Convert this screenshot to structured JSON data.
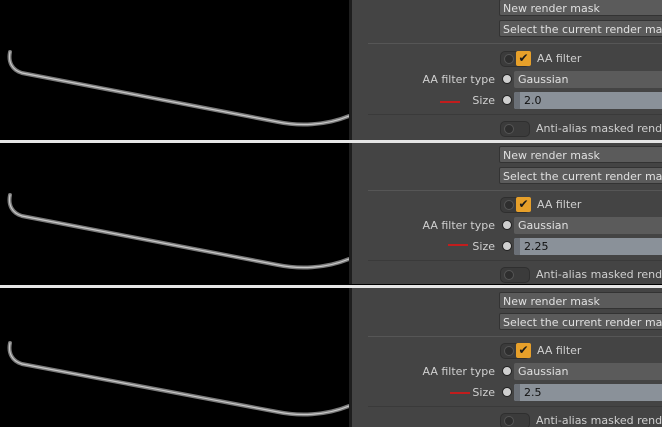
{
  "panels": [
    {
      "new_render_mask": "New render mask",
      "select_mask": "Select the current render mask",
      "aa_filter_label": "AA filter",
      "aa_filter_checked": true,
      "aa_filter_type_label": "AA filter type",
      "aa_filter_type_value": "Gaussian",
      "size_label": "Size",
      "size_value": "2.0",
      "anti_alias_label": "Anti-alias masked render o"
    },
    {
      "new_render_mask": "New render mask",
      "select_mask": "Select the current render mask",
      "aa_filter_label": "AA filter",
      "aa_filter_checked": true,
      "aa_filter_type_label": "AA filter type",
      "aa_filter_type_value": "Gaussian",
      "size_label": "Size",
      "size_value": "2.25",
      "anti_alias_label": "Anti-alias masked render o"
    },
    {
      "new_render_mask": "New render mask",
      "select_mask": "Select the current render mask",
      "aa_filter_label": "AA filter",
      "aa_filter_checked": true,
      "aa_filter_type_label": "AA filter type",
      "aa_filter_type_value": "Gaussian",
      "size_label": "Size",
      "size_value": "2.5",
      "anti_alias_label": "Anti-alias masked render o"
    }
  ],
  "colors": {
    "accent_check": "#e7a02a",
    "keyframe_marker": "#c21d1d",
    "panel_bg": "#444444",
    "viewport_bg": "#000000"
  },
  "icons": [
    "check-icon",
    "radio-dot-icon",
    "toggle-icon",
    "keyframe-marker-icon"
  ]
}
